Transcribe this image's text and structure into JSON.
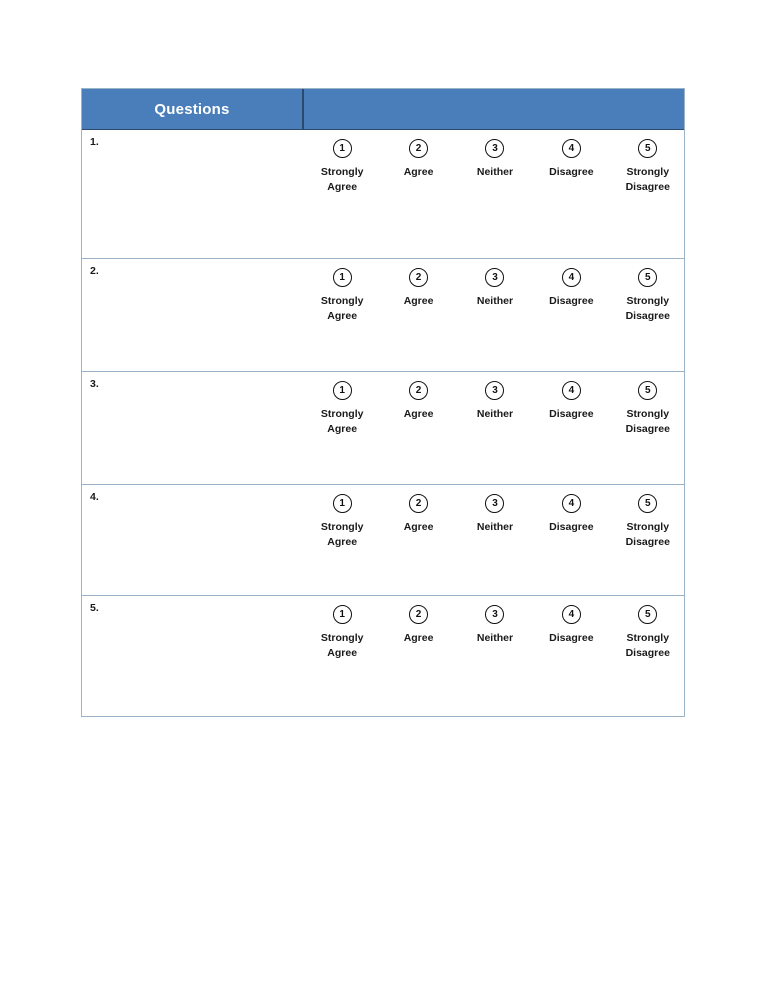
{
  "document": {
    "type": "likert-survey-table",
    "page_background": "#ffffff"
  },
  "colors": {
    "header_background": "#4a7ebb",
    "header_text": "#ffffff",
    "table_border": "#9bb3c9",
    "header_divider": "#2c4a6e",
    "body_text": "#1a1a1a",
    "circle_stroke": "#111111"
  },
  "table": {
    "header": {
      "questions_label": "Questions",
      "scale_label": ""
    },
    "scale_options": [
      {
        "number": "1",
        "label": "Strongly Agree"
      },
      {
        "number": "2",
        "label": "Agree"
      },
      {
        "number": "3",
        "label": "Neither"
      },
      {
        "number": "4",
        "label": "Disagree"
      },
      {
        "number": "5",
        "label": "Strongly Disagree"
      }
    ],
    "rows": [
      {
        "number": "1.",
        "question_text": ""
      },
      {
        "number": "2.",
        "question_text": ""
      },
      {
        "number": "3.",
        "question_text": ""
      },
      {
        "number": "4.",
        "question_text": ""
      },
      {
        "number": "5.",
        "question_text": ""
      }
    ]
  }
}
